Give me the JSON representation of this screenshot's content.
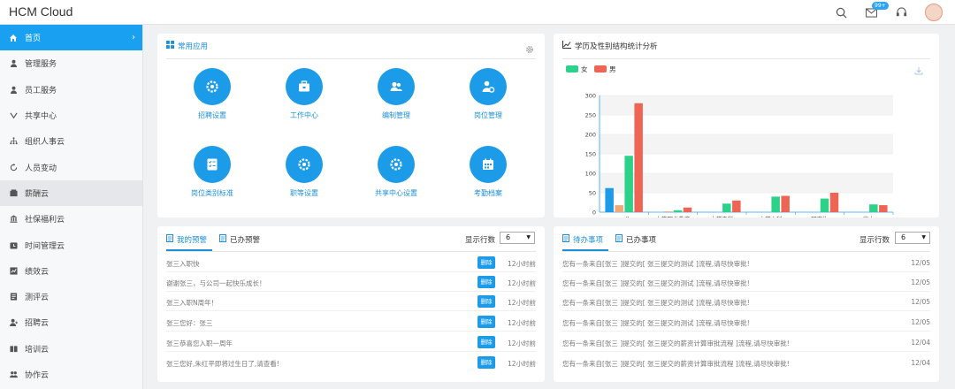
{
  "header": {
    "title": "HCM Cloud",
    "mail_badge": "99+"
  },
  "sidebar": {
    "items": [
      {
        "label": "首页",
        "icon": "home-icon"
      },
      {
        "label": "管理服务",
        "icon": "user-icon"
      },
      {
        "label": "员工服务",
        "icon": "user-icon"
      },
      {
        "label": "共享中心",
        "icon": "share-icon"
      },
      {
        "label": "组织人事云",
        "icon": "org-icon"
      },
      {
        "label": "人员变动",
        "icon": "refresh-icon"
      },
      {
        "label": "薪酬云",
        "icon": "wallet-icon"
      },
      {
        "label": "社保福利云",
        "icon": "building-icon"
      },
      {
        "label": "时间管理云",
        "icon": "clock-icon"
      },
      {
        "label": "绩效云",
        "icon": "chart-icon"
      },
      {
        "label": "测评云",
        "icon": "doc-icon"
      },
      {
        "label": "招聘云",
        "icon": "user-plus-icon"
      },
      {
        "label": "培训云",
        "icon": "book-icon"
      },
      {
        "label": "协作云",
        "icon": "team-icon"
      }
    ]
  },
  "apps": {
    "title": "常用应用",
    "items": [
      {
        "label": "招聘设置"
      },
      {
        "label": "工作中心"
      },
      {
        "label": "编制管理"
      },
      {
        "label": "岗位管理"
      },
      {
        "label": "岗位类别标准"
      },
      {
        "label": "职等设置"
      },
      {
        "label": "共享中心设置"
      },
      {
        "label": "考勤档案"
      }
    ]
  },
  "stats": {
    "title": "学历及性别结构统计分析"
  },
  "chart_data": {
    "type": "bar",
    "categories": [
      "null",
      "中等职业教育",
      "大学专科",
      "大学本科",
      "研究生",
      "高中"
    ],
    "series": [
      {
        "name": "",
        "values": [
          62,
          0,
          0,
          0,
          0,
          0
        ],
        "color": "#1c9be8"
      },
      {
        "name": "",
        "values": [
          18,
          2,
          0,
          0,
          0,
          0
        ],
        "color": "#f0a87a"
      },
      {
        "name": "女",
        "values": [
          145,
          5,
          22,
          40,
          35,
          20
        ],
        "color": "#2dd28a"
      },
      {
        "name": "男",
        "values": [
          280,
          12,
          30,
          42,
          50,
          18
        ],
        "color": "#ee6555"
      }
    ],
    "ylim": [
      0,
      300
    ],
    "yticks": [
      0,
      50,
      100,
      150,
      200,
      250,
      300
    ],
    "legend": "top-left"
  },
  "warnings": {
    "tabs": [
      "我的预警",
      "已办预警"
    ],
    "rows_label": "显示行数",
    "rows_value": "6",
    "delete_label": "删除",
    "items": [
      {
        "text": "张三入职快",
        "time": "12小时前"
      },
      {
        "text": "谢谢张三，与公司一起快乐成长！",
        "time": "12小时前"
      },
      {
        "text": "张三入职N周年！",
        "time": "12小时前"
      },
      {
        "text": "张三您好：张三",
        "time": "12小时前"
      },
      {
        "text": "张三恭喜您入职一周年",
        "time": "12小时前"
      },
      {
        "text": "张三您好,朱红平即将过生日了,请查看!",
        "time": "12小时前"
      }
    ]
  },
  "todos": {
    "tabs": [
      "待办事项",
      "已办事项"
    ],
    "rows_label": "显示行数",
    "rows_value": "6",
    "items": [
      {
        "text": "您有一条来自[张三 ]提交的[ 张三提交的测试 ]流程,请尽快审批!",
        "date": "12/05"
      },
      {
        "text": "您有一条来自[张三 ]提交的[ 张三提交的测试 ]流程,请尽快审批!",
        "date": "12/05"
      },
      {
        "text": "您有一条来自[张三 ]提交的[ 张三提交的测试 ]流程,请尽快审批!",
        "date": "12/05"
      },
      {
        "text": "您有一条来自[张三 ]提交的[ 张三提交的测试 ]流程,请尽快审批!",
        "date": "12/05"
      },
      {
        "text": "您有一条来自[张三 ]提交的[ 张三提交的薪资计算审批流程 ]流程,请尽快审批!",
        "date": "12/04"
      },
      {
        "text": "您有一条来自[张三 ]提交的[ 张三提交的薪资计算审批流程 ]流程,请尽快审批!",
        "date": "12/04"
      }
    ]
  }
}
